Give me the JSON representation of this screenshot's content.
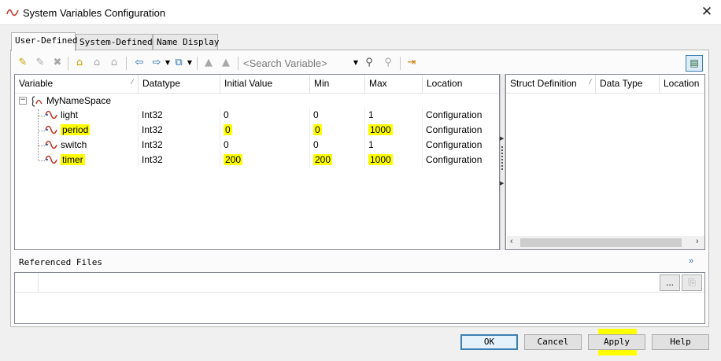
{
  "window": {
    "title": "System Variables Configuration",
    "close_glyph": "✕"
  },
  "tabs": [
    {
      "label": "User-Defined",
      "active": true
    },
    {
      "label": "System-Defined",
      "active": false
    },
    {
      "label": "Name Display",
      "active": false
    }
  ],
  "toolbar": {
    "search_placeholder": "<Search Variable>"
  },
  "table": {
    "columns": [
      "Variable",
      "Datatype",
      "Initial Value",
      "Min",
      "Max",
      "Location"
    ],
    "namespace": "MyNameSpace",
    "rows": [
      {
        "name": "light",
        "datatype": "Int32",
        "initial": "0",
        "min": "0",
        "max": "1",
        "location": "Configuration"
      },
      {
        "name": "period",
        "datatype": "Int32",
        "initial": "0",
        "min": "0",
        "max": "1000",
        "location": "Configuration"
      },
      {
        "name": "switch",
        "datatype": "Int32",
        "initial": "0",
        "min": "0",
        "max": "1",
        "location": "Configuration"
      },
      {
        "name": "timer",
        "datatype": "Int32",
        "initial": "200",
        "min": "200",
        "max": "1000",
        "location": "Configuration"
      }
    ]
  },
  "struct_panel": {
    "columns": [
      "Struct Definition",
      "Data Type",
      "Location"
    ]
  },
  "referenced_files": {
    "title": "Referenced Files",
    "browse_label": "..."
  },
  "buttons": {
    "ok": "OK",
    "cancel": "Cancel",
    "apply": "Apply",
    "help": "Help"
  },
  "colors": {
    "highlight": "#ffff00",
    "accent": "#3c7fb1"
  }
}
